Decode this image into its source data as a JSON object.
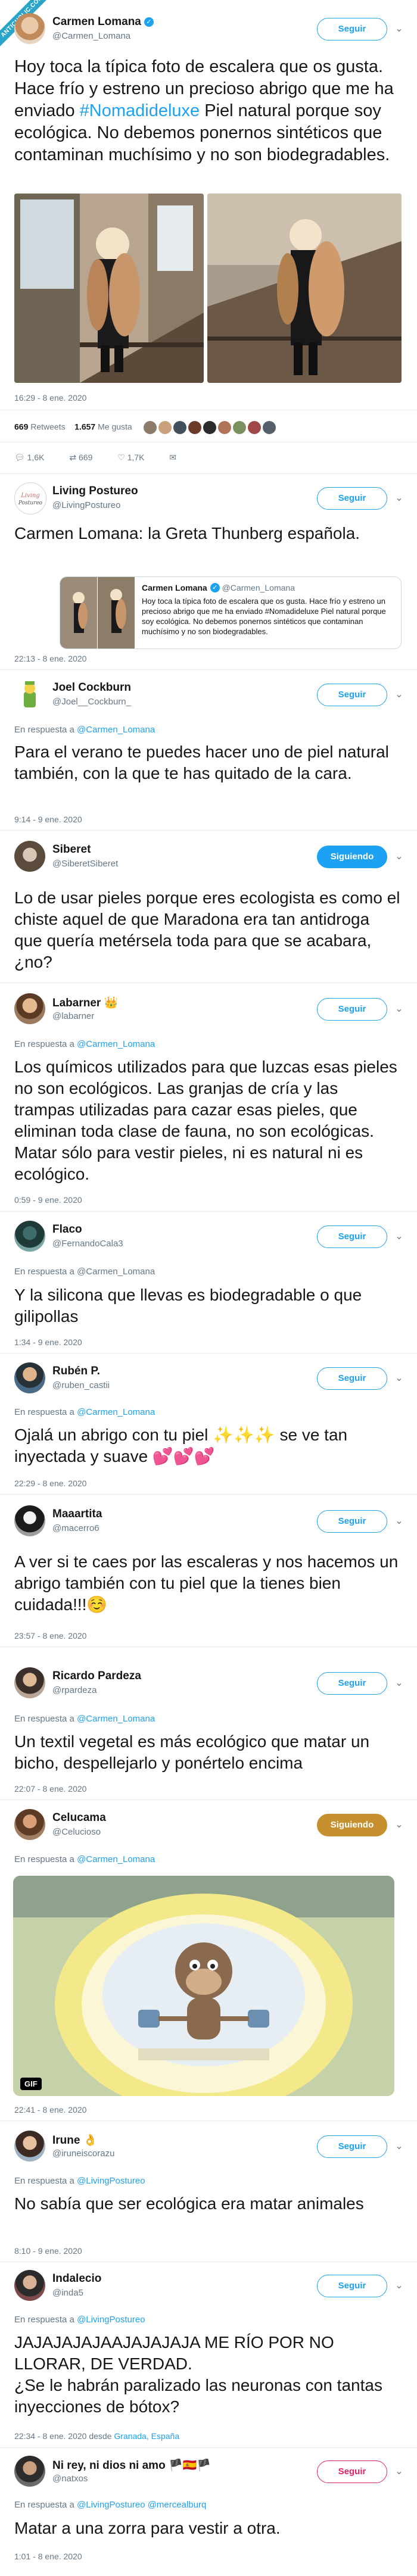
{
  "watermark": "ANTICHOLIC.COM",
  "main": {
    "name": "Carmen Lomana",
    "handle": "@Carmen_Lomana",
    "follow": "Seguir",
    "text_parts": [
      "Hoy toca la típica foto de escalera que os gusta.  Hace frío y estreno un precioso abrigo que me ha enviado ",
      "#Nomadideluxe",
      "  Piel natural porque soy ecológica. No debemos ponernos sintéticos que contaminan muchísimo y no son biodegradables."
    ],
    "timestamp": "16:29 - 8 ene. 2020",
    "retweets_num": "669",
    "retweets_label": "Retweets",
    "likes_num": "1.657",
    "likes_label": "Me gusta",
    "replies": "1,6K",
    "rts": "669",
    "favs": "1,7K"
  },
  "replies": [
    {
      "name": "Living Postureo",
      "handle": "@LivingPostureo",
      "follow": "Seguir",
      "reply_to": "",
      "text": "Carmen Lomana: la Greta Thunberg española.",
      "time": "22:13 - 8 ene. 2020",
      "quote": {
        "name": "Carmen Lomana",
        "handle": "@Carmen_Lomana",
        "text": "Hoy toca la típica foto de escalera que os gusta.  Hace frío y estreno un precioso abrigo que me ha enviado #Nomadideluxe  Piel natural porque soy ecológica. No debemos ponernos sintéticos que contaminan muchísimo y no son biodegradables."
      }
    },
    {
      "name": "Joel Cockburn",
      "handle": "@Joel__Cockburn_",
      "follow": "Seguir",
      "reply_prefix": "En respuesta a ",
      "reply_to": "@Carmen_Lomana",
      "text": "Para el verano te puedes hacer uno de piel natural también, con la que te has quitado de la cara.",
      "time": "9:14 - 9 ene. 2020"
    },
    {
      "name": "Siberet",
      "handle": "@SiberetSiberet",
      "follow": "Siguiendo",
      "reply_prefix": "",
      "reply_to": "",
      "text": "Lo de usar pieles porque eres ecologista es como el chiste aquel de que Maradona era tan antidroga que quería metérsela toda para que se acabara, ¿no?",
      "time": ""
    },
    {
      "name": "Labarner",
      "handle": "@labarner",
      "follow": "Seguir",
      "reply_prefix": "En respuesta a ",
      "reply_to": "@Carmen_Lomana",
      "text": "Los químicos utilizados para que luzcas esas pieles no son ecológicos. Las granjas de cría y las trampas utilizadas para cazar esas pieles, que eliminan toda clase de fauna, no son ecológicas. Matar sólo para vestir pieles, ni es natural ni es ecológico.",
      "time": "0:59 - 9 ene. 2020"
    },
    {
      "name": "Flaco",
      "handle": "@FernandoCala3",
      "follow": "Seguir",
      "reply_prefix": "En respuesta a ",
      "reply_to": "@Carmen_Lomana",
      "text": "Y la silicona que llevas es biodegradable o que gilipollas",
      "time": "1:34 - 9 ene. 2020"
    },
    {
      "name": "Rubén P.",
      "handle": "@ruben_castii",
      "follow": "Seguir",
      "reply_prefix": "En respuesta a ",
      "reply_to": "@Carmen_Lomana",
      "text": "Ojalá un abrigo con tu piel ✨✨✨ se ve tan inyectada y suave 💕💕💕",
      "time": "22:29 - 8 ene. 2020"
    },
    {
      "name": "Maaartita",
      "handle": "@macerro6",
      "follow": "Seguir",
      "reply_prefix": "",
      "reply_to": "",
      "text": "A ver si te caes por las escaleras y nos hacemos un abrigo también con tu piel que la tienes bien cuidada!!!☺️",
      "time": "23:57 - 8 ene. 2020"
    },
    {
      "name": "Ricardo Pardeza",
      "handle": "@rpardeza",
      "follow": "Seguir",
      "reply_prefix": "En respuesta a ",
      "reply_to": "@Carmen_Lomana",
      "text": "Un textil vegetal es más ecológico que matar un bicho, despellejarlo y ponértelo encima",
      "time": "22:07 - 8 ene. 2020"
    },
    {
      "name": "Celucama",
      "handle": "@Celucioso",
      "follow": "Siguiendo",
      "reply_prefix": "En respuesta a ",
      "reply_to": "@Carmen_Lomana",
      "text": "",
      "time": "22:41 - 8 ene. 2020",
      "gif_label": "GIF"
    },
    {
      "name": "Irune",
      "handle": "@iruneiscorazu",
      "follow": "Seguir",
      "reply_prefix": "En respuesta a ",
      "reply_to": "@LivingPostureo",
      "text": "No sabía que ser ecológica era matar animales",
      "time": "8:10 - 9 ene. 2020"
    },
    {
      "name": "Indalecio",
      "handle": "@inda5",
      "follow": "Seguir",
      "reply_prefix": "En respuesta a ",
      "reply_to": "@LivingPostureo",
      "text": "JAJAJAJAJAAJAJAJAJA ME RÍO POR NO LLORAR, DE VERDAD.\n¿Se le habrán paralizado las neuronas con tantas inyecciones de bótox?",
      "time": "22:34 - 8 ene. 2020 desde ",
      "geo": "Granada, España"
    },
    {
      "name": "Ni rey, ni dios ni amo 🏴🇪🇸🏴",
      "handle": "@natxos",
      "follow": "Seguir",
      "reply_prefix": "En respuesta a ",
      "reply_to": "@LivingPostureo @mercealburq",
      "text": "Matar a una zorra para vestir a otra.",
      "time": "1:01 - 8 ene. 2020"
    }
  ],
  "colors": {
    "accent": "#1da1f2",
    "following_gold": "#c6902e",
    "muted": "#657786",
    "text": "#14171a"
  }
}
